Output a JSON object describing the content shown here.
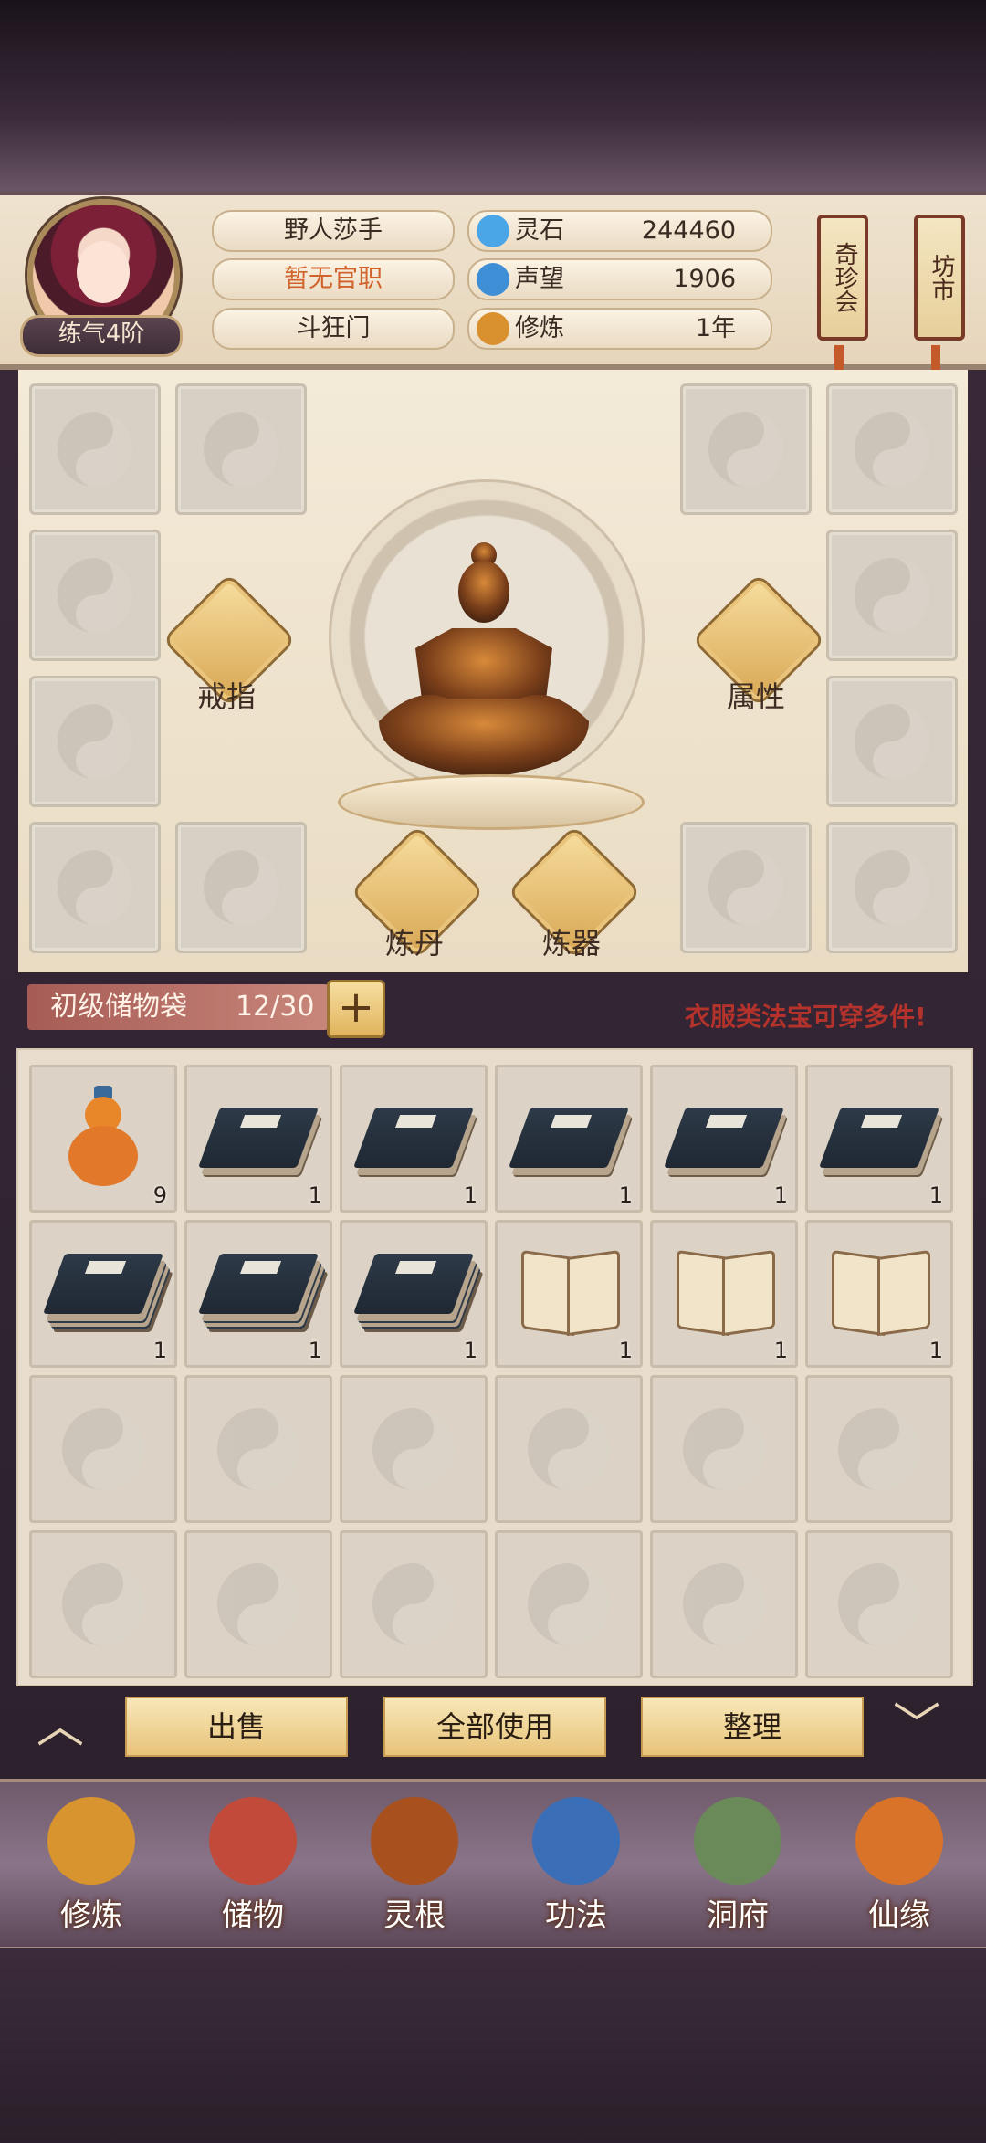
{
  "player": {
    "name": "野人莎手",
    "official_rank": "暂无官职",
    "sect": "斗狂门",
    "cultivation_level": "练气4阶"
  },
  "stats": [
    {
      "label": "灵石",
      "value": "244460",
      "icon": "spirit-stone-icon",
      "color": "#4aa6e6"
    },
    {
      "label": "声望",
      "value": "1906",
      "icon": "reputation-crystal-icon",
      "color": "#3f8fd6"
    },
    {
      "label": "修炼",
      "value": "1年",
      "icon": "meditation-icon",
      "color": "#d9902f"
    }
  ],
  "side_buttons": [
    {
      "label": "奇珍会"
    },
    {
      "label": "坊市"
    }
  ],
  "equipment": {
    "ring_label": "戒指",
    "attributes_label": "属性",
    "alchemy_label": "炼丹",
    "forging_label": "炼器"
  },
  "bag": {
    "title": "初级储物袋",
    "count": "12/30",
    "add_label": "+",
    "notice": "衣服类法宝可穿多件!"
  },
  "inventory": [
    {
      "type": "gourd",
      "qty": "9"
    },
    {
      "type": "book",
      "qty": "1"
    },
    {
      "type": "book",
      "qty": "1"
    },
    {
      "type": "book",
      "qty": "1"
    },
    {
      "type": "book",
      "qty": "1"
    },
    {
      "type": "book",
      "qty": "1"
    },
    {
      "type": "book-stack",
      "qty": "1"
    },
    {
      "type": "book-stack",
      "qty": "1"
    },
    {
      "type": "book-stack",
      "qty": "1"
    },
    {
      "type": "open-book",
      "qty": "1"
    },
    {
      "type": "open-book",
      "qty": "1"
    },
    {
      "type": "open-book",
      "qty": "1"
    }
  ],
  "actions": {
    "sell": "出售",
    "use_all": "全部使用",
    "sort": "整理"
  },
  "nav": [
    {
      "label": "修炼",
      "icon": "cultivate-icon",
      "color": "#d8942e"
    },
    {
      "label": "储物",
      "icon": "storage-bag-icon",
      "color": "#c24a3a"
    },
    {
      "label": "灵根",
      "icon": "spirit-root-icon",
      "color": "#a8501e"
    },
    {
      "label": "功法",
      "icon": "technique-book-icon",
      "color": "#3a6fb8"
    },
    {
      "label": "洞府",
      "icon": "cave-house-icon",
      "color": "#6a8a5a"
    },
    {
      "label": "仙缘",
      "icon": "immortal-gourd-icon",
      "color": "#d9732a"
    }
  ]
}
